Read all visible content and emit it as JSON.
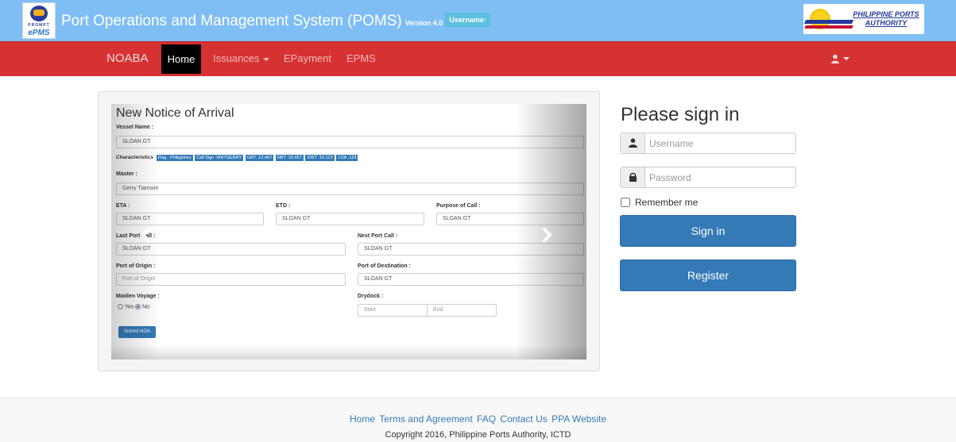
{
  "header": {
    "logo_left": {
      "line1": "PROMPT",
      "line2": "ePMS"
    },
    "title": "Port Operations and Management System (POMS)",
    "version": "Version 4.0",
    "username_badge": "Username:",
    "logo_right": {
      "name": "PHILIPPINE PORTS AUTHORITY"
    }
  },
  "nav": {
    "brand": "NOABA",
    "items": [
      {
        "label": "Home",
        "active": true
      },
      {
        "label": "Issuances",
        "dropdown": true
      },
      {
        "label": "EPayment"
      },
      {
        "label": "EPMS"
      }
    ],
    "user_icon": "user-icon"
  },
  "carousel": {
    "slide": {
      "title": "New Notice of Arrival",
      "vessel_name_label": "Vessel Name :",
      "vessel_name_value": "SLOAN GT",
      "characteristics_label": "Characteristics",
      "characteristics": [
        "Flag : Philippines",
        "Call Sign :WRTGERRY",
        "GRT :12,467",
        "NRT :10,467",
        "DWT :10,123",
        "LOA :123"
      ],
      "master_label": "Master :",
      "master_value": "Gerry Tiamsim",
      "eta_label": "ETA :",
      "eta_value": "SLOAN GT",
      "etd_label": "ETD :",
      "etd_value": "SLOAN GT",
      "purpose_label": "Purpose of Call :",
      "purpose_value": "SLOAN GT",
      "last_port_label": "Last Port Call :",
      "last_port_value": "SLOAN GT",
      "next_port_label": "Next Port Call :",
      "next_port_value": "SLOAN GT",
      "origin_label": "Port of Origin :",
      "origin_placeholder": "Port of Origin",
      "destination_label": "Port of Destination :",
      "destination_value": "SLOAN GT",
      "maiden_label": "Maiden Voyage :",
      "maiden_yes": "Yes",
      "maiden_no": "No",
      "maiden_selected": "No",
      "drydock_label": "Drydock :",
      "drydock_start": "Start",
      "drydock_end": "End",
      "submit_label": "Submit NOA"
    },
    "prev_icon": "chevron-left-icon",
    "next_icon": "chevron-right-icon",
    "indicator": "..."
  },
  "signin": {
    "title": "Please sign in",
    "username_placeholder": "Username",
    "password_placeholder": "Password",
    "remember_label": "Remember me",
    "signin_button": "Sign in",
    "register_button": "Register"
  },
  "footer": {
    "links": [
      "Home",
      "Terms and Agreement",
      "FAQ",
      "Contact Us",
      "PPA Website"
    ],
    "copyright": "Copyright 2016, Philippine Ports Authority, ICTD"
  },
  "colors": {
    "header_bg": "#7fbef5",
    "nav_bg": "#d73232",
    "primary": "#337ab7",
    "badge": "#5bc0de"
  }
}
